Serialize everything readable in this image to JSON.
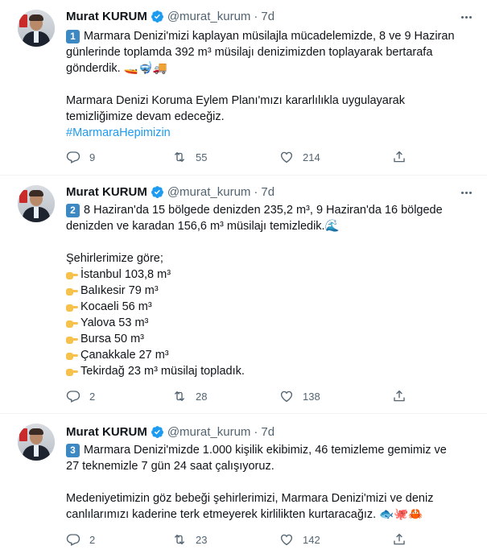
{
  "tweets": [
    {
      "name": "Murat KURUM",
      "handle": "@murat_kurum",
      "dot": "·",
      "time": "7d",
      "badge": "1",
      "lines": [
        "Marmara Denizi'mizi kaplayan müsilajla mücadelemizde, 8 ve 9 Haziran",
        "günlerinde toplamda 392 m³ müsilajı denizimizden toplayarak bertarafa",
        "gönderdik. 🚤🤿🚚",
        "",
        "Marmara Denizi Koruma Eylem Planı'mızı kararlılıkla uygulayarak",
        "temizliğimize devam edeceğiz."
      ],
      "hashtag": "#MarmaraHepimizin",
      "replies": "9",
      "retweets": "55",
      "likes": "214"
    },
    {
      "name": "Murat KURUM",
      "handle": "@murat_kurum",
      "dot": "·",
      "time": "7d",
      "badge": "2",
      "lines": [
        "8 Haziran'da 15 bölgede denizden 235,2 m³, 9 Haziran'da 16 bölgede",
        "denizden ve karadan 156,6 m³ müsilajı temizledik.🌊",
        "",
        "Şehirlerimize göre;"
      ],
      "cities": [
        "İstanbul 103,8 m³",
        "Balıkesir 79 m³",
        "Kocaeli 56 m³",
        "Yalova 53 m³",
        "Bursa 50 m³",
        "Çanakkale 27 m³",
        "Tekirdağ 23 m³ müsilaj topladık."
      ],
      "replies": "2",
      "retweets": "28",
      "likes": "138"
    },
    {
      "name": "Murat KURUM",
      "handle": "@murat_kurum",
      "dot": "·",
      "time": "7d",
      "badge": "3",
      "lines": [
        "Marmara Denizi'mizde 1.000 kişilik ekibimiz, 46 temizleme gemimiz ve",
        "27 teknemizle 7 gün 24 saat çalışıyoruz.",
        "",
        "Medeniyetimizin göz bebeği şehirlerimizi, Marmara Denizi'mizi ve deniz",
        "canlılarımızı kaderine terk etmeyerek kirlilikten kurtaracağız. 🐟🐙🦀"
      ],
      "replies": "2",
      "retweets": "23",
      "likes": "142"
    }
  ],
  "colors": {
    "text": "#0f1419",
    "secondary": "#536471",
    "link": "#1d9bf0",
    "verified": "#1d9bf0",
    "badge": "#3b88c3"
  },
  "icons": [
    "verified-icon",
    "more-icon",
    "reply-icon",
    "retweet-icon",
    "like-icon",
    "share-icon",
    "point-right-icon"
  ]
}
